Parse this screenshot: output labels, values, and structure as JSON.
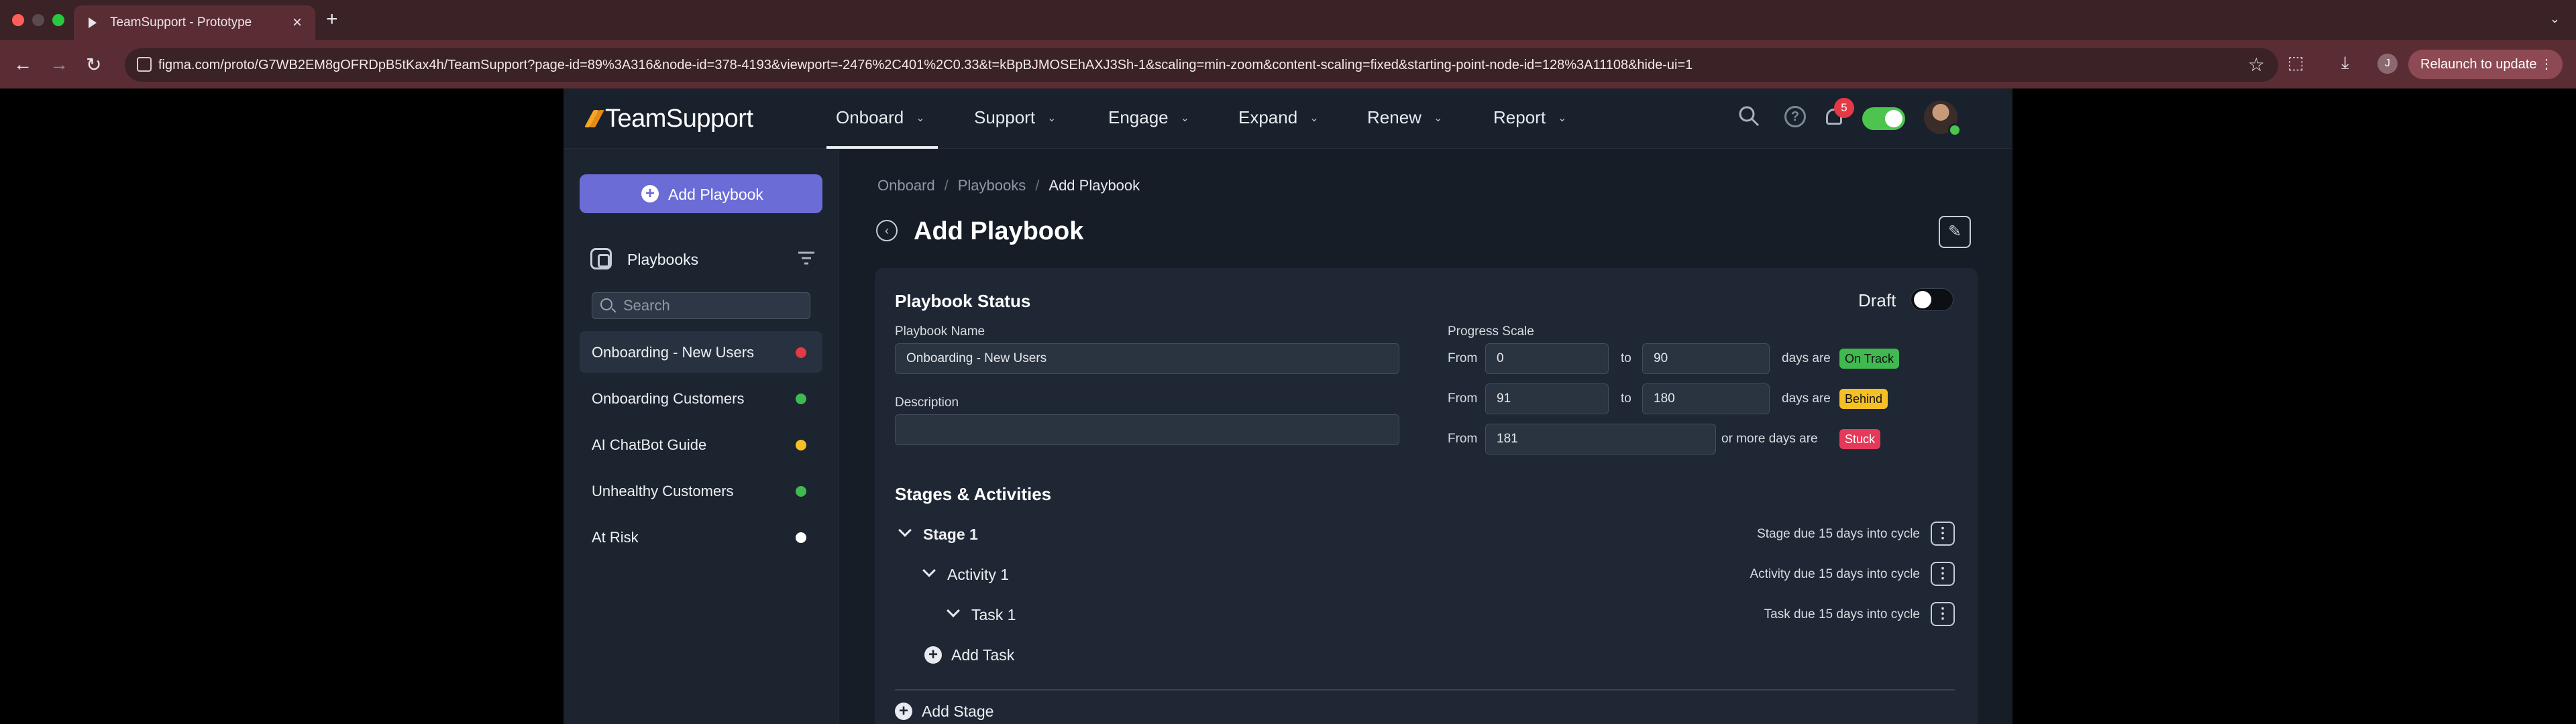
{
  "browser": {
    "tab_title": "TeamSupport - Prototype",
    "url": "figma.com/proto/G7WB2EM8gOFRDpB5tKax4h/TeamSupport?page-id=89%3A316&node-id=378-4193&viewport=-2476%2C401%2C0.33&t=kBpBJMOSEhAXJ3Sh-1&scaling=min-zoom&content-scaling=fixed&starting-point-node-id=128%3A11108&hide-ui=1",
    "profile_initial": "J",
    "relaunch_label": "Relaunch to update"
  },
  "app": {
    "logo_text": "TeamSupport",
    "menu": [
      {
        "label": "Onboard"
      },
      {
        "label": "Support"
      },
      {
        "label": "Engage"
      },
      {
        "label": "Expand"
      },
      {
        "label": "Renew"
      },
      {
        "label": "Report"
      }
    ],
    "notification_count": "5"
  },
  "sidebar": {
    "add_button_label": "Add Playbook",
    "section_title": "Playbooks",
    "search_placeholder": "Search",
    "items": [
      {
        "name": "Onboarding - New Users",
        "color": "#e53945"
      },
      {
        "name": "Onboarding Customers",
        "color": "#3fb950"
      },
      {
        "name": "AI ChatBot Guide",
        "color": "#f5c026"
      },
      {
        "name": "Unhealthy Customers",
        "color": "#3fb950"
      },
      {
        "name": "At Risk",
        "color": "#ffffff"
      }
    ]
  },
  "main": {
    "breadcrumb": [
      "Onboard",
      "Playbooks",
      "Add Playbook"
    ],
    "title": "Add Playbook",
    "status_section": {
      "heading": "Playbook Status",
      "draft_label": "Draft",
      "name_label": "Playbook Name",
      "name_value": "Onboarding - New Users",
      "description_label": "Description",
      "description_value": "",
      "progress_label": "Progress Scale",
      "from_label": "From",
      "to_label": "to",
      "days_are": "days are",
      "or_more_days_are": "or more days are",
      "scale": [
        {
          "from": "0",
          "to": "90",
          "status": "On Track",
          "color": "#3fb950"
        },
        {
          "from": "91",
          "to": "180",
          "status": "Behind",
          "color": "#f5c026"
        },
        {
          "from": "181",
          "status": "Stuck",
          "color": "#e5395a"
        }
      ]
    },
    "stages_section": {
      "heading": "Stages & Activities",
      "stage_title": "Stage 1",
      "stage_due": "Stage due 15 days into cycle",
      "activity_title": "Activity 1",
      "activity_due": "Activity due 15 days into cycle",
      "task_title": "Task 1",
      "task_due": "Task due 15 days into cycle",
      "add_task_label": "Add Task",
      "add_stage_label": "Add Stage"
    }
  }
}
